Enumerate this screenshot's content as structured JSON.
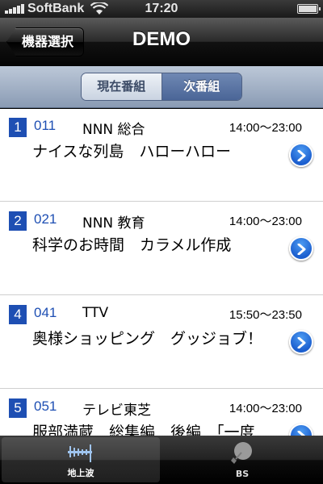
{
  "status": {
    "carrier": "SoftBank",
    "time": "17:20"
  },
  "nav": {
    "back_label": "機器選択",
    "title": "DEMO"
  },
  "segments": [
    {
      "label": "現在番組",
      "selected": false
    },
    {
      "label": "次番組",
      "selected": true
    }
  ],
  "rows": [
    {
      "badge": "1",
      "channel": "011",
      "name": "NNN 総合",
      "time": "14:00〜23:00",
      "program": "ナイスな列島　ハローハロー"
    },
    {
      "badge": "2",
      "channel": "021",
      "name": "NNN 教育",
      "time": "14:00〜23:00",
      "program": "科学のお時間　カラメル作成"
    },
    {
      "badge": "4",
      "channel": "041",
      "name": "TTV",
      "time": "15:50〜23:50",
      "program": "奥様ショッピング　グッジョブ！"
    },
    {
      "badge": "5",
      "channel": "051",
      "name": "テレビ東芝",
      "time": "14:00〜23:00",
      "program": "服部満蔵　総集編　後編　「一度"
    }
  ],
  "tabs": [
    {
      "label": "地上波",
      "icon": "antenna-icon",
      "active": true
    },
    {
      "label": "BS",
      "icon": "satellite-dish-icon",
      "active": false
    }
  ],
  "colors": {
    "accent_blue": "#1e4fb3",
    "segment_selected": "#4a6597"
  }
}
